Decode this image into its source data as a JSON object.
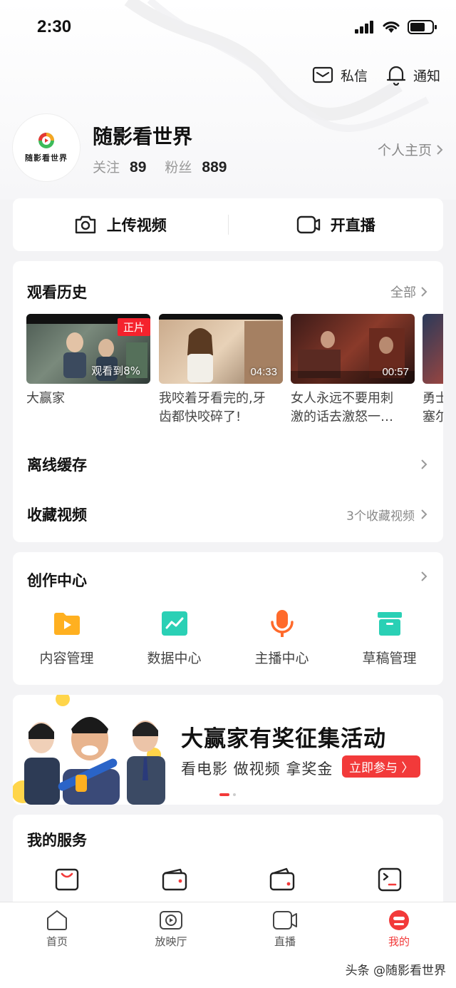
{
  "status_bar": {
    "time": "2:30"
  },
  "header": {
    "messages_label": "私信",
    "notifications_label": "通知"
  },
  "profile": {
    "name": "随影看世界",
    "avatar_text": "随影看世界",
    "following_label": "关注",
    "following_count": "89",
    "fans_label": "粉丝",
    "fans_count": "889",
    "homepage_label": "个人主页"
  },
  "actions": {
    "upload_label": "上传视频",
    "live_label": "开直播"
  },
  "history": {
    "title": "观看历史",
    "all_label": "全部",
    "items": [
      {
        "title": "大赢家",
        "tag": "正片",
        "progress": "观看到8%",
        "duration": ""
      },
      {
        "title": "我咬着牙看完的,牙齿都快咬碎了!",
        "tag": "",
        "progress": "",
        "duration": "04:33"
      },
      {
        "title": "女人永远不要用刺激的话去激怒一…",
        "tag": "",
        "progress": "",
        "duration": "00:57"
      },
      {
        "title": "勇士塞尔",
        "tag": "",
        "progress": "",
        "duration": ""
      }
    ]
  },
  "offline": {
    "title": "离线缓存"
  },
  "favorites": {
    "title": "收藏视频",
    "count_label": "3个收藏视频"
  },
  "creation": {
    "title": "创作中心",
    "items": [
      {
        "label": "内容管理",
        "icon": "folder-play-icon",
        "color": "#ffb020"
      },
      {
        "label": "数据中心",
        "icon": "chart-icon",
        "color": "#2ad0b5"
      },
      {
        "label": "主播中心",
        "icon": "microphone-icon",
        "color": "#ff6a2b"
      },
      {
        "label": "草稿管理",
        "icon": "archive-box-icon",
        "color": "#2ad0b5"
      }
    ]
  },
  "banner": {
    "title": "大赢家有奖征集活动",
    "subtitle": "看电影 做视频 拿奖金",
    "button_label": "立即参与 〉"
  },
  "services": {
    "title": "我的服务",
    "icons": [
      "shopping-bag-icon",
      "wallet-icon",
      "wallet-alt-icon",
      "id-card-icon"
    ]
  },
  "tabbar": {
    "items": [
      {
        "label": "首页",
        "icon": "home-icon"
      },
      {
        "label": "放映厅",
        "icon": "play-screen-icon"
      },
      {
        "label": "直播",
        "icon": "live-camera-icon"
      },
      {
        "label": "我的",
        "icon": "profile-icon",
        "active": true
      }
    ]
  },
  "watermark": "头条 @随影看世界",
  "colors": {
    "accent": "#f23a3a",
    "background": "#f3f3f5"
  }
}
